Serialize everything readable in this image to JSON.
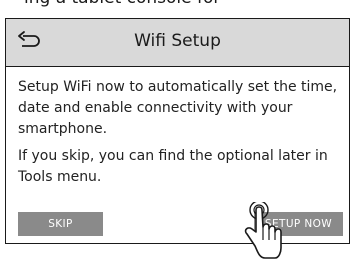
{
  "cut_off_text": "ing a tablet console for",
  "header": {
    "title": "Wifi Setup",
    "back_icon": "back-arrow-icon"
  },
  "body": {
    "paragraph1": "Setup WiFi now to automatically set the time, date and enable connectivity with your smartphone.",
    "paragraph2": "If you skip, you can find the optional later in Tools menu."
  },
  "buttons": {
    "skip": "SKIP",
    "setup_now": "SETUP NOW"
  },
  "overlay": {
    "icon": "hand-pointer-icon"
  },
  "colors": {
    "header_bg": "#d9d9d9",
    "button_bg": "#8a8a8a",
    "border": "#1a1a1a"
  }
}
